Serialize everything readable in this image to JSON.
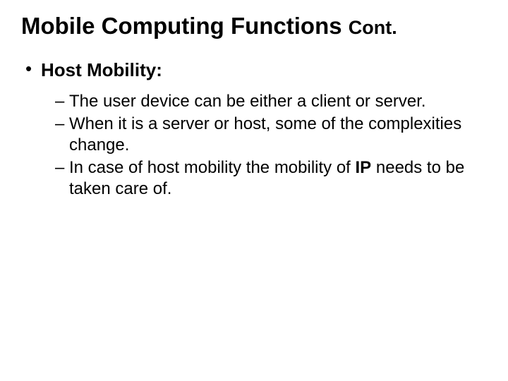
{
  "title_main": "Mobile Computing Functions ",
  "title_cont": "Cont.",
  "section_label": "Host Mobility:",
  "sub1_pre": "The user device can be either a client or server.",
  "sub2": "When it is a server or host, some of the complexities change.",
  "sub3_pre": "In case of host mobility the mobility of ",
  "sub3_bold": "IP",
  "sub3_post": " needs to be taken care of.",
  "dash": "–"
}
